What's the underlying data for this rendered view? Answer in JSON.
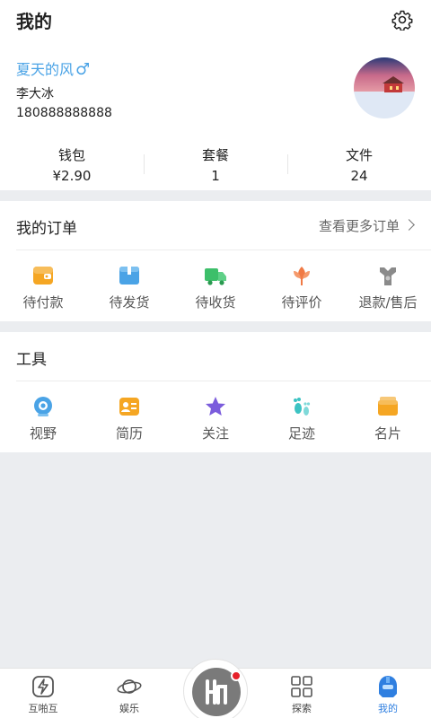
{
  "header": {
    "title": "我的",
    "settings_icon": "gear-icon"
  },
  "profile": {
    "nickname": "夏天的风",
    "gender_symbol": "♂",
    "real_name": "李大冰",
    "phone": "180888888888",
    "avatar": "house-snow-landscape"
  },
  "stats": [
    {
      "label": "钱包",
      "value": "¥2.90"
    },
    {
      "label": "套餐",
      "value": "1"
    },
    {
      "label": "文件",
      "value": "24"
    }
  ],
  "orders": {
    "title": "我的订单",
    "more_label": "查看更多订单",
    "items": [
      {
        "label": "待付款",
        "icon": "wallet-icon",
        "color": "#f5a623"
      },
      {
        "label": "待发货",
        "icon": "box-icon",
        "color": "#4aa3e6"
      },
      {
        "label": "待收货",
        "icon": "truck-icon",
        "color": "#3dbf6a"
      },
      {
        "label": "待评价",
        "icon": "flower-icon",
        "color": "#f07a45"
      },
      {
        "label": "退款/售后",
        "icon": "wrench-icon",
        "color": "#8a8a8a"
      }
    ]
  },
  "tools": {
    "title": "工具",
    "items": [
      {
        "label": "视野",
        "icon": "camera-icon",
        "color": "#4aa3e6"
      },
      {
        "label": "简历",
        "icon": "resume-icon",
        "color": "#f5a623"
      },
      {
        "label": "关注",
        "icon": "star-icon",
        "color": "#7b5cdc"
      },
      {
        "label": "足迹",
        "icon": "footprint-icon",
        "color": "#3cc3c3"
      },
      {
        "label": "名片",
        "icon": "card-icon",
        "color": "#f5a623"
      }
    ]
  },
  "nav": {
    "items": [
      {
        "label": "互啪互",
        "icon": "lightning-icon"
      },
      {
        "label": "娱乐",
        "icon": "planet-icon"
      },
      {
        "label": "探索",
        "icon": "grid-icon"
      },
      {
        "label": "我的",
        "icon": "helmet-icon"
      }
    ],
    "center_icon": "logo-icon",
    "active_color": "#2f7fe0"
  }
}
